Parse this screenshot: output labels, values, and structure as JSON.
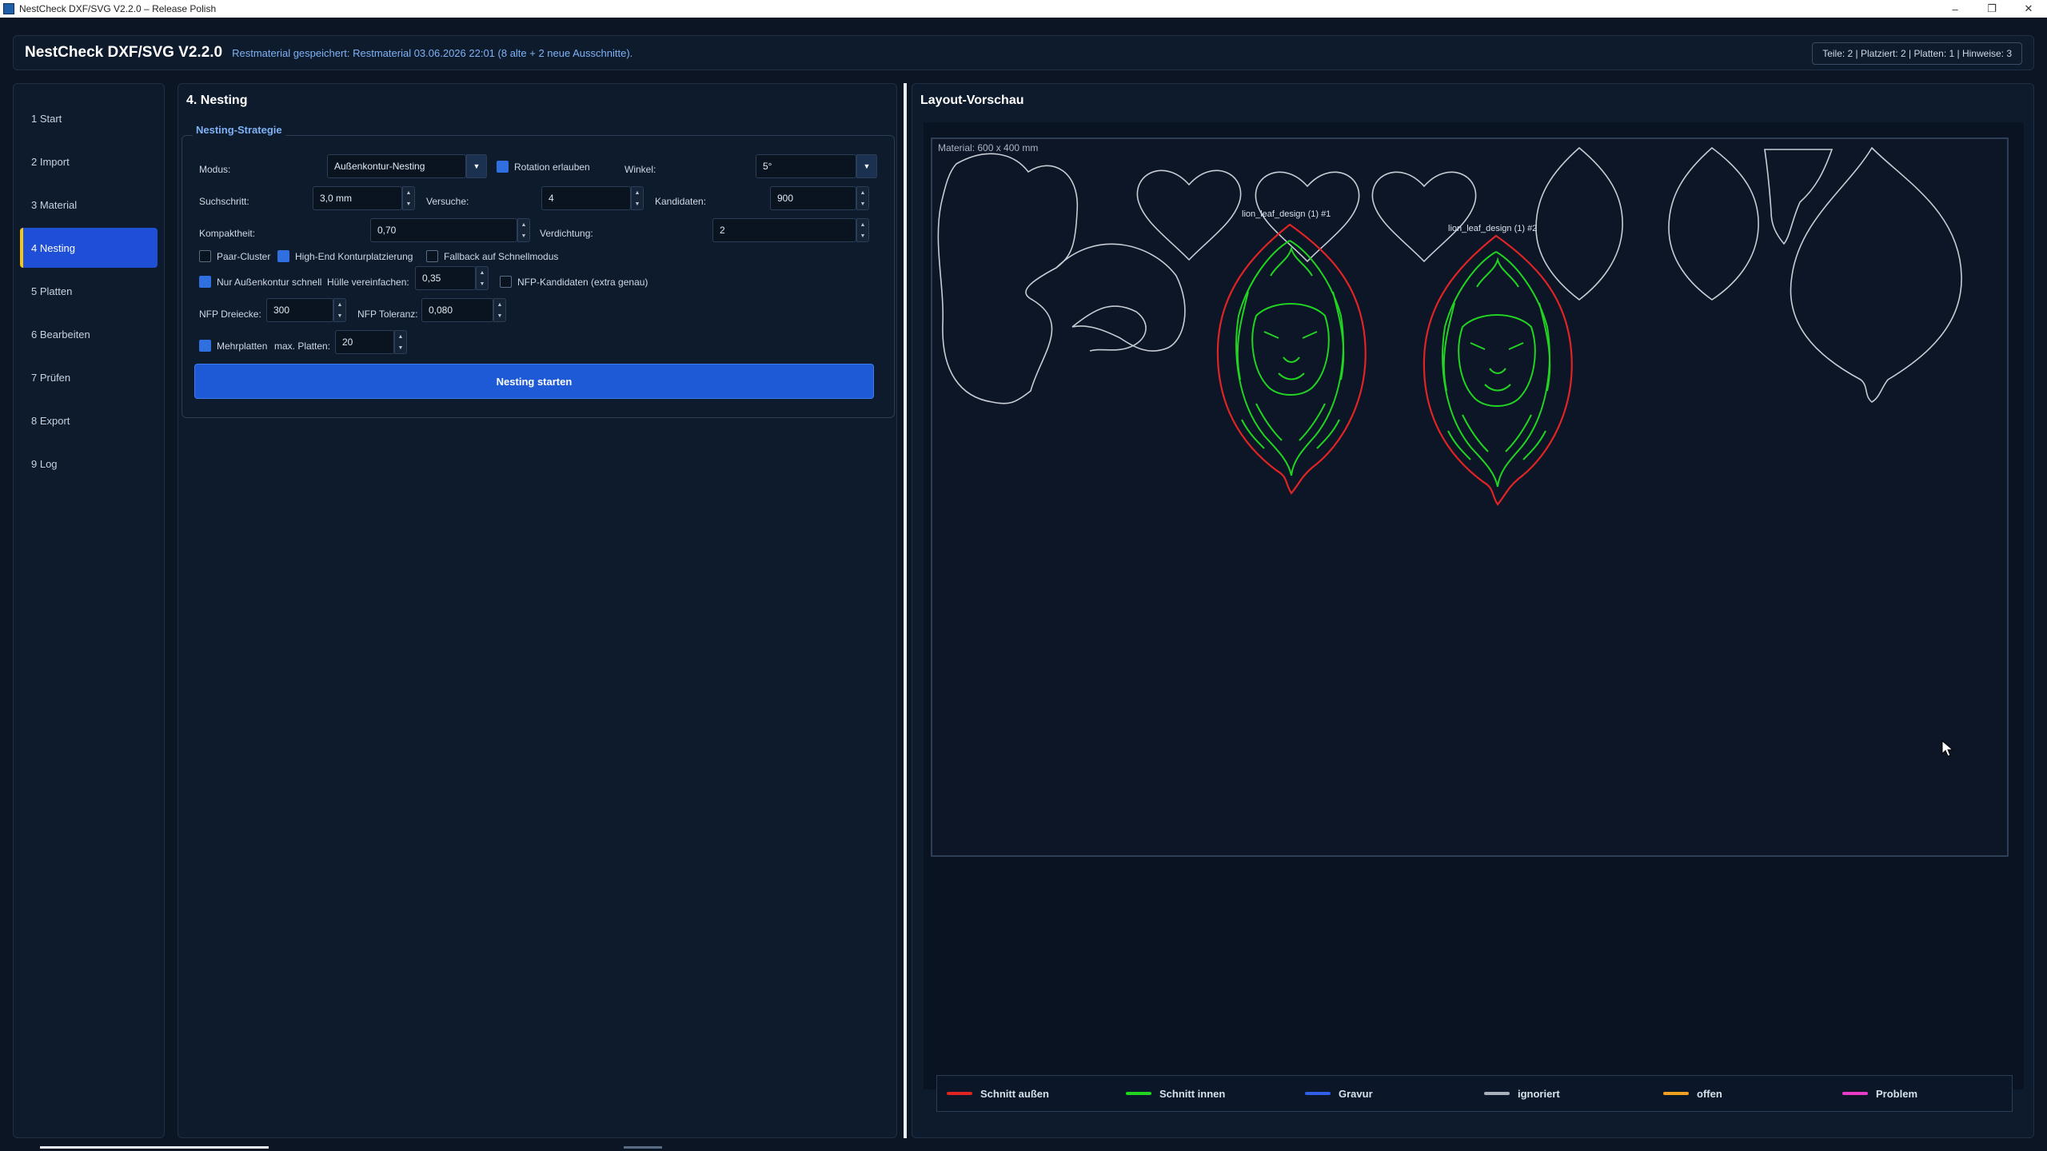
{
  "window": {
    "title": "NestCheck DXF/SVG V2.2.0 – Release Polish",
    "minimize_glyph": "–",
    "maximize_glyph": "❐",
    "close_glyph": "✕"
  },
  "header": {
    "title": "NestCheck DXF/SVG V2.2.0",
    "status": "Restmaterial gespeichert: Restmaterial 03.06.2026 22:01 (8 alte + 2 neue Ausschnitte).",
    "counts": "Teile: 2 | Platziert: 2 | Platten: 1 | Hinweise: 3"
  },
  "sidebar": {
    "items": [
      {
        "label": "1  Start"
      },
      {
        "label": "2  Import"
      },
      {
        "label": "3  Material"
      },
      {
        "label": "4  Nesting",
        "active": true
      },
      {
        "label": "5  Platten"
      },
      {
        "label": "6  Bearbeiten"
      },
      {
        "label": "7  Prüfen"
      },
      {
        "label": "8  Export"
      },
      {
        "label": "9  Log"
      }
    ]
  },
  "nesting": {
    "section_title": "4. Nesting",
    "group_title": "Nesting-Strategie",
    "modus_label": "Modus:",
    "modus_value": "Außenkontur-Nesting",
    "rotation_label": "Rotation erlauben",
    "rotation_checked": true,
    "winkel_label": "Winkel:",
    "winkel_value": "5°",
    "suchschritt_label": "Suchschritt:",
    "suchschritt_value": "3,0 mm",
    "versuche_label": "Versuche:",
    "versuche_value": "4",
    "kandidaten_label": "Kandidaten:",
    "kandidaten_value": "900",
    "kompaktheit_label": "Kompaktheit:",
    "kompaktheit_value": "0,70",
    "verdichtung_label": "Verdichtung:",
    "verdichtung_value": "2",
    "paar_cluster_label": "Paar-Cluster",
    "paar_cluster_checked": false,
    "highend_label": "High-End Konturplatzierung",
    "highend_checked": true,
    "fallback_label": "Fallback auf Schnellmodus",
    "fallback_checked": false,
    "nur_aussen_label": "Nur Außenkontur schnell",
    "nur_aussen_checked": true,
    "huelle_label": "Hülle vereinfachen:",
    "huelle_value": "0,35",
    "nfp_kandidaten_label": "NFP-Kandidaten (extra genau)",
    "nfp_kandidaten_checked": false,
    "nfp_dreiecke_label": "NFP Dreiecke:",
    "nfp_dreiecke_value": "300",
    "nfp_toleranz_label": "NFP Toleranz:",
    "nfp_toleranz_value": "0,080",
    "mehrplatten_label": "Mehrplatten",
    "mehrplatten_checked": true,
    "max_platten_label": "max. Platten:",
    "max_platten_value": "20",
    "start_button": "Nesting starten"
  },
  "preview": {
    "title": "Layout-Vorschau",
    "material_label": "Material: 600 x 400 mm",
    "part_labels": [
      "lion_leaf_design (1) #1",
      "lion_leaf_design (1) #2"
    ],
    "legend": [
      {
        "label": "Schnitt außen",
        "color": "#e02424"
      },
      {
        "label": "Schnitt innen",
        "color": "#22d422"
      },
      {
        "label": "Gravur",
        "color": "#2f5fe8"
      },
      {
        "label": "ignoriert",
        "color": "#a8b0bc"
      },
      {
        "label": "offen",
        "color": "#f0a020"
      },
      {
        "label": "Problem",
        "color": "#e83cc8"
      }
    ]
  },
  "colors": {
    "accent": "#1f5ad6",
    "active_marker": "#f5c518",
    "outer_cut": "#e02424",
    "inner_cut": "#22d422",
    "remnant_outline": "#c8ccd4"
  }
}
